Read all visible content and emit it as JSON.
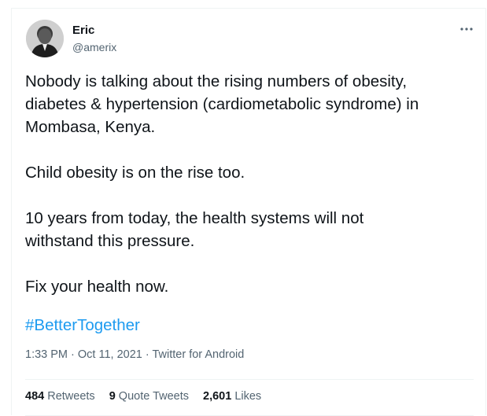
{
  "author": {
    "name": "Eric",
    "handle": "@amerix"
  },
  "tweet": {
    "paragraphs": [
      "Nobody is talking about the rising numbers of obesity,\ndiabetes & hypertension (cardiometabolic syndrome) in\nMombasa, Kenya.",
      "Child obesity is on the rise too.",
      "10 years from today, the health systems will not\nwithstand this pressure.",
      "Fix your health now."
    ],
    "hashtag": "#BetterTogether"
  },
  "meta": {
    "time": "1:33 PM",
    "sep1": " · ",
    "date": "Oct 11, 2021",
    "sep2": " · ",
    "source": "Twitter for Android"
  },
  "stats": {
    "retweets_count": "484",
    "retweets_label": "Retweets",
    "quotes_count": "9",
    "quotes_label": "Quote Tweets",
    "likes_count": "2,601",
    "likes_label": "Likes"
  },
  "colors": {
    "link": "#1d9bf0",
    "secondary_text": "#536471",
    "primary_text": "#0f1419",
    "border": "#eff3f4"
  },
  "icons": {
    "more": "more-dots-icon",
    "avatar": "profile-photo"
  }
}
